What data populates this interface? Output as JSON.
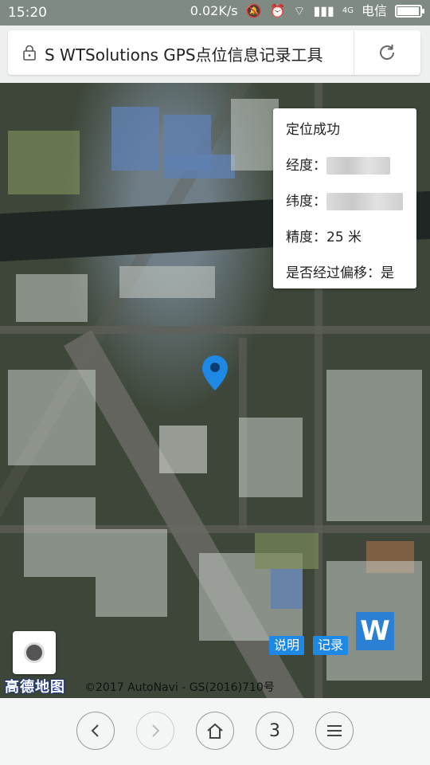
{
  "status_bar": {
    "time": "15:20",
    "speed": "0.02K/s",
    "network": "4G",
    "carrier": "电信"
  },
  "browser": {
    "page_title": "S WTSolutions GPS点位信息记录工具"
  },
  "info_panel": {
    "status": "定位成功",
    "longitude_label": "经度：",
    "latitude_label": "纬度：",
    "accuracy": "精度：25 米",
    "offset": "是否经过偏移：是"
  },
  "map": {
    "logo": "高德地图",
    "copyright": "©2017 AutoNavi - GS(2016)710号",
    "help_button": "说明",
    "record_button": "记录",
    "w_logo": "W"
  },
  "bottom_nav": {
    "tab_count": "3"
  },
  "colors": {
    "accent": "#1e88e5",
    "pin": "#1e88e5"
  }
}
